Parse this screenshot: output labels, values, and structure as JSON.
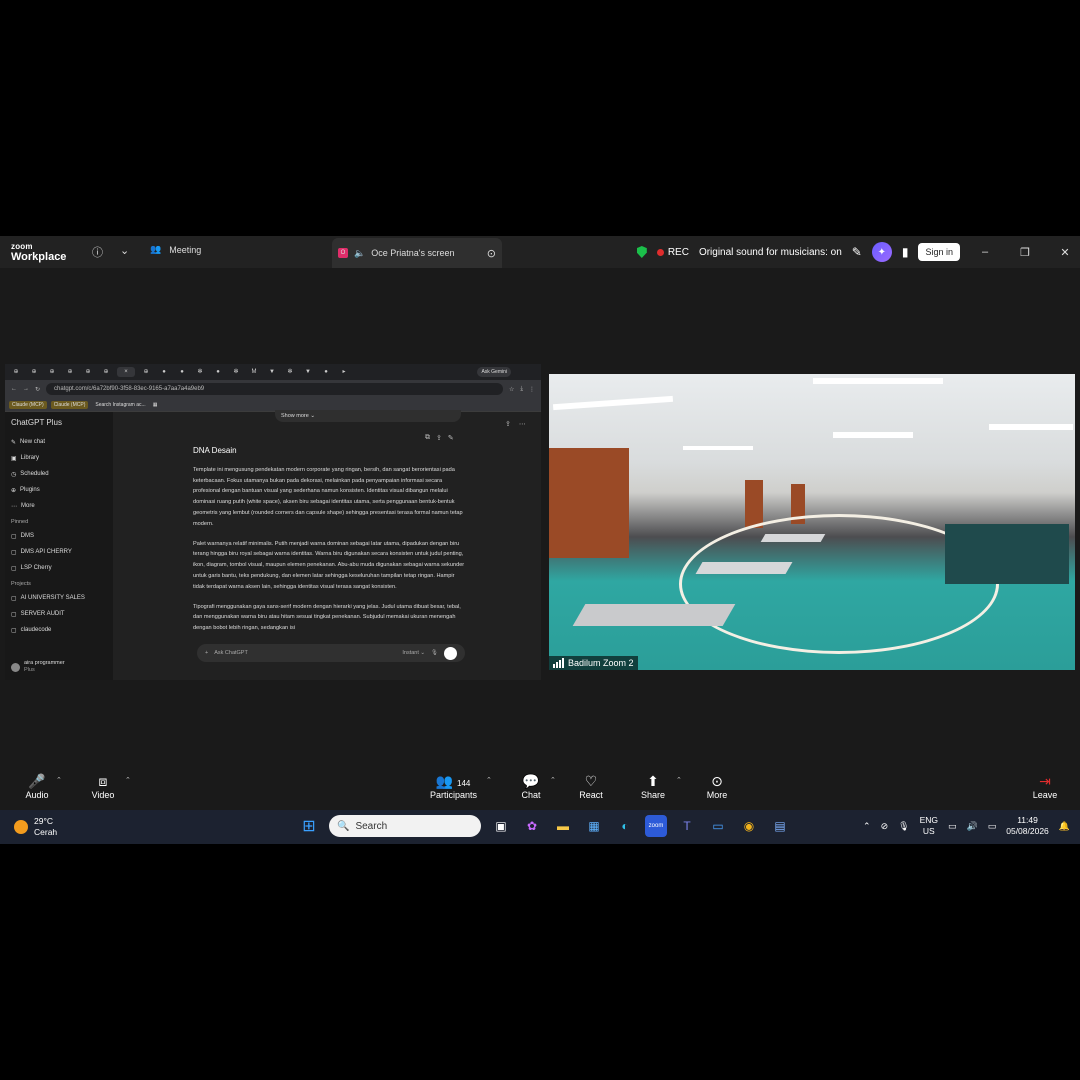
{
  "zoom": {
    "logo_top": "zoom",
    "logo_bottom": "Workplace",
    "meeting_tab": "Meeting",
    "screen_tab_badge": "O",
    "screen_tab": "Oce Priatna's screen",
    "rec": "REC",
    "sound": "Original sound for musicians: on",
    "signin": "Sign in",
    "win_minimize": "–",
    "win_restore": "❐",
    "win_close": "✕"
  },
  "browser": {
    "url": "chatgpt.com/c/6a72bf90-3f58-83ec-9165-a7aa7a4a9eb9",
    "gemini": "Ask Gemini",
    "bookmarks": [
      "Claude (MCP)",
      "Claude (MCP)",
      "Search Instagram ac..."
    ],
    "tab_glyphs": [
      "⊕",
      "⊕",
      "⊕",
      "⊕",
      "⊕",
      "⊕",
      "×",
      "⊕",
      "●",
      "●",
      "✻",
      "●",
      "✻",
      "M",
      "▼",
      "✻",
      "▼",
      "●",
      "▸"
    ]
  },
  "chatgpt": {
    "brand": "ChatGPT Plus",
    "menu": [
      "New chat",
      "Library",
      "Scheduled",
      "Plugins",
      "More"
    ],
    "pinned_label": "Pinned",
    "pinned": [
      "DMS",
      "DMS API CHERRY",
      "LSP Cherry"
    ],
    "projects_label": "Projects",
    "projects": [
      "AI UNIVERSITY SALES",
      "SERVER AUDIT",
      "claudecode"
    ],
    "user_name": "aira programmer",
    "user_plan": "Plus",
    "show_more": "Show more",
    "heading": "DNA Desain",
    "p1": "Template ini mengusung pendekatan modern corporate yang ringan, bersih, dan sangat berorientasi pada keterbacaan. Fokus utamanya bukan pada dekorasi, melainkan pada penyampaian informasi secara profesional dengan bantuan visual yang sederhana namun konsisten. Identitas visual dibangun melalui dominasi ruang putih (white space), aksen biru sebagai identitas utama, serta penggunaan bentuk-bentuk geometris yang lembut (rounded corners dan capsule shape) sehingga presentasi terasa formal namun tetap modern.",
    "p2": "Palet warnanya relatif minimalis. Putih menjadi warna dominan sebagai latar utama, dipadukan dengan biru terang hingga biru royal sebagai warna identitas. Warna biru digunakan secara konsisten untuk judul penting, ikon, diagram, tombol visual, maupun elemen penekanan. Abu-abu muda digunakan sebagai warna sekunder untuk garis bantu, teks pendukung, dan elemen latar sehingga keseluruhan tampilan tetap ringan. Hampir tidak terdapat warna aksen lain, sehingga identitas visual terasa sangat konsisten.",
    "p3": "Tipografi menggunakan gaya sans-serif modern dengan hierarki yang jelas. Judul utama dibuat besar, tebal, dan menggunakan warna biru atau hitam sesuai tingkat penekanan. Subjudul memakai ukuran menengah dengan bobot lebih ringan, sedangkan isi",
    "composer_placeholder": "Ask ChatGPT",
    "composer_mode": "Instant ⌄"
  },
  "video": {
    "label": "Badilum Zoom 2"
  },
  "controls": {
    "audio": "Audio",
    "video": "Video",
    "participants": "Participants",
    "participants_count": "144",
    "chat": "Chat",
    "react": "React",
    "share": "Share",
    "more": "More",
    "leave": "Leave"
  },
  "taskbar": {
    "temp": "29°C",
    "condition": "Cerah",
    "search": "Search",
    "lang_top": "ENG",
    "lang_bottom": "US",
    "time": "11:49",
    "date": "05/08/2026"
  }
}
